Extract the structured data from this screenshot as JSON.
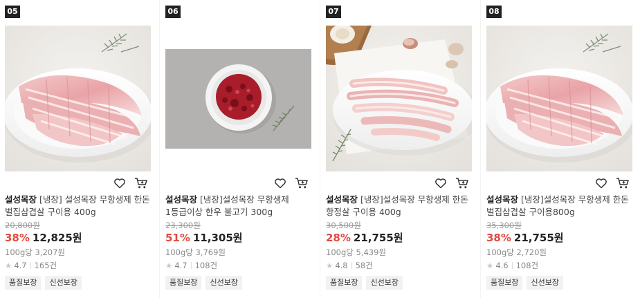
{
  "products": [
    {
      "rank": "05",
      "brand": "설성목장",
      "name": "[냉장] 설성목장 무항생제 한돈 벌집삼겹살 구이용 400g",
      "original_price": "20,800원",
      "discount": "38%",
      "price": "12,825원",
      "unit_price": "100g당 3,207원",
      "rating": "4.7",
      "reviews": "165건",
      "badges": [
        "품질보장",
        "신선보장"
      ],
      "image": "pork-belly-plate-icon"
    },
    {
      "rank": "06",
      "brand": "설성목장",
      "name": "[냉장]설성목장 무항생제 1등급이상 한우 불고기 300g",
      "original_price": "23,300원",
      "discount": "51%",
      "price": "11,305원",
      "unit_price": "100g당 3,769원",
      "rating": "4.7",
      "reviews": "108건",
      "badges": [
        "품질보장",
        "신선보장"
      ],
      "image": "beef-bulgogi-plate-icon"
    },
    {
      "rank": "07",
      "brand": "설성목장",
      "name": "[냉장]설성목장 무항생제 한돈 항정살 구이용 400g",
      "original_price": "30,500원",
      "discount": "28%",
      "price": "21,755원",
      "unit_price": "100g당 5,439원",
      "rating": "4.8",
      "reviews": "58건",
      "badges": [
        "품질보장",
        "신선보장"
      ],
      "image": "pork-jowl-plate-icon"
    },
    {
      "rank": "08",
      "brand": "설성목장",
      "name": "[냉장]설성목장 무항생제 한돈 벌집삼겹살 구이용800g",
      "original_price": "35,300원",
      "discount": "38%",
      "price": "21,755원",
      "unit_price": "100g당 2,720원",
      "rating": "4.6",
      "reviews": "108건",
      "badges": [
        "품질보장",
        "신선보장"
      ],
      "image": "pork-belly-plate-icon"
    }
  ],
  "colors": {
    "discount": "#e2493f",
    "badge_bg": "#f2f2f2",
    "rank_bg": "#222222"
  }
}
